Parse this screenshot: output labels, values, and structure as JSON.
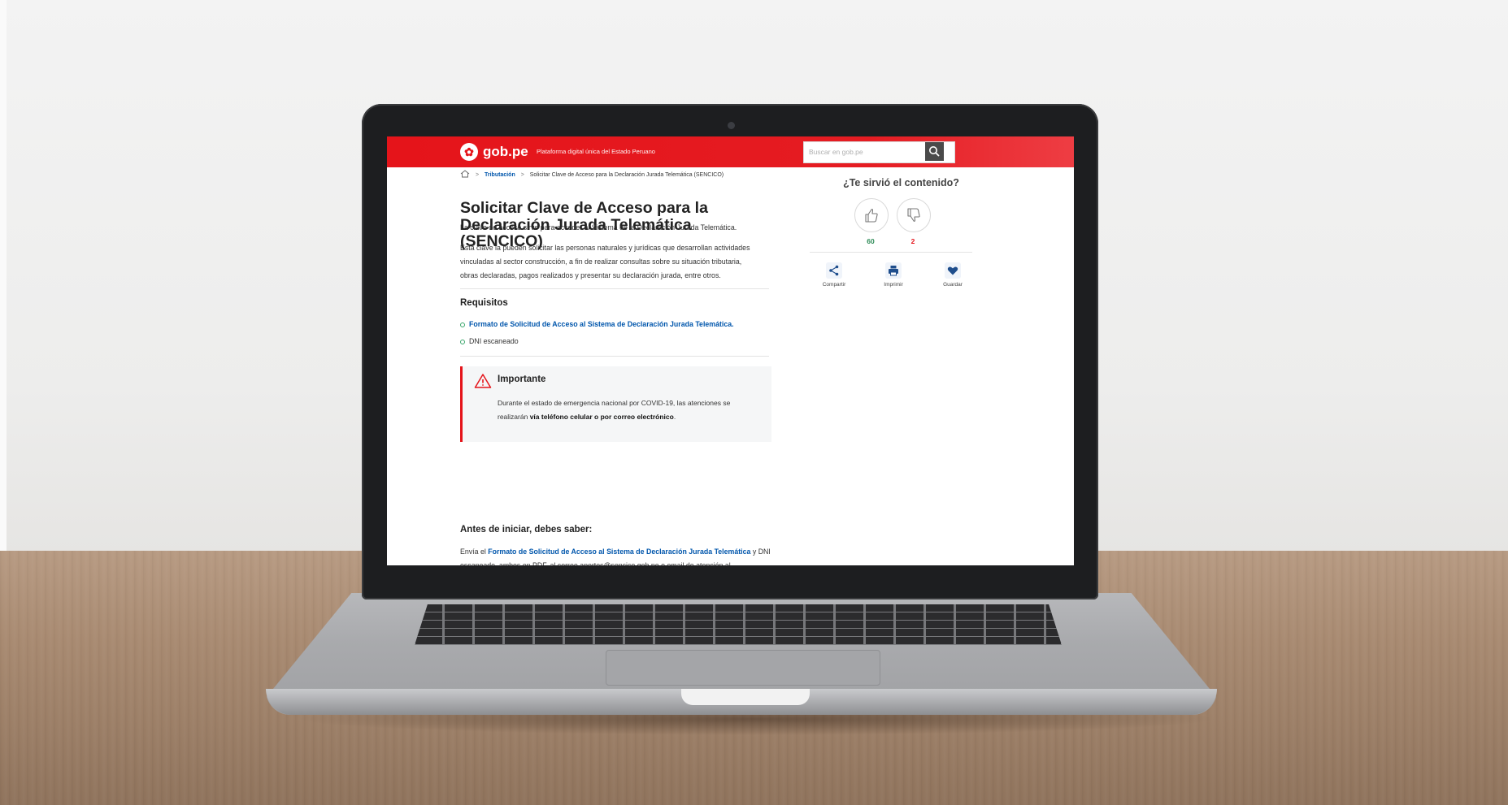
{
  "header": {
    "brand": "gob.pe",
    "tagline": "Plataforma digital única del Estado Peruano",
    "search_placeholder": "Buscar en gob.pe",
    "accent_color": "#e5141a"
  },
  "breadcrumb": {
    "home_icon": "home-icon",
    "section": "Tributación",
    "current": "Solicitar Clave de Acceso para la Declaración Jurada Telemática (SENCICO)"
  },
  "article": {
    "title": "Solicitar Clave de Acceso para la Declaración Jurada Telemática (SENCICO)",
    "intro": "La clave de acceso sirve para acceder al Sistema de la Declaración Jurada Telemática.",
    "description": "Esta clave la pueden solicitar las personas naturales y jurídicas que desarrollan actividades vinculadas al sector construcción, a fin de realizar consultas sobre su situación tributaria, obras declaradas, pagos realizados y presentar su declaración jurada, entre otros.",
    "requirements_heading": "Requisitos",
    "requirements": [
      "Formato de Solicitud de Acceso al Sistema de Declaración Jurada Telemática.",
      "DNI escaneado"
    ],
    "alert": {
      "title": "Importante",
      "body_plain": "Durante el estado de emergencia nacional por COVID-19, las atenciones se realizarán ",
      "body_bold": "vía teléfono celular o por correo electrónico",
      "body_end": "."
    },
    "before_heading": "Antes de iniciar, debes saber:",
    "before_text_1": "Envía el ",
    "before_link": "Formato de Solicitud de Acceso al Sistema de Declaración Jurada Telemática",
    "before_text_2": " y DNI",
    "before_cut_line": "escaneado, ambos en PDF, al correo aportes@sencico.gob.pe o email de atención al"
  },
  "feedback": {
    "question": "¿Te sirvió el contenido?",
    "likes": "60",
    "dislikes": "2",
    "like_color": "#2e8b57",
    "dislike_color": "#e5141a"
  },
  "actions": [
    {
      "label": "Compartir",
      "icon": "share-icon"
    },
    {
      "label": "Imprimir",
      "icon": "print-icon"
    },
    {
      "label": "Guardar",
      "icon": "heart-icon"
    }
  ]
}
